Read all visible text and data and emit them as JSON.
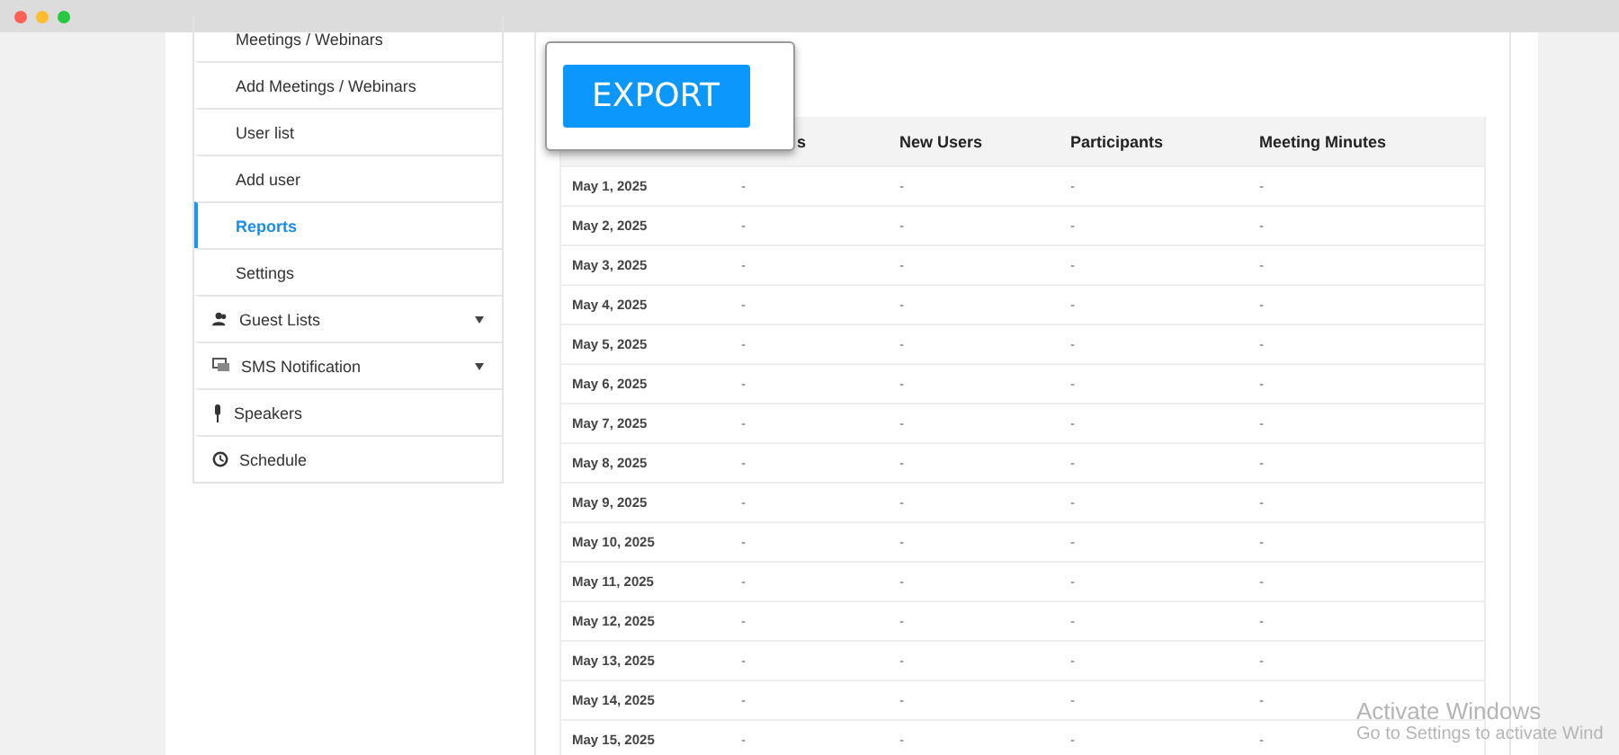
{
  "sidebar": {
    "items": [
      {
        "label": "Meetings / Webinars",
        "kind": "link",
        "selected": false
      },
      {
        "label": "Add Meetings / Webinars",
        "kind": "link",
        "selected": false
      },
      {
        "label": "User list",
        "kind": "link",
        "selected": false
      },
      {
        "label": "Add user",
        "kind": "link",
        "selected": false
      },
      {
        "label": "Reports",
        "kind": "link",
        "selected": true
      },
      {
        "label": "Settings",
        "kind": "link",
        "selected": false
      },
      {
        "label": "Guest Lists",
        "kind": "menu",
        "expandable": true,
        "selected": false
      },
      {
        "label": "SMS Notification",
        "kind": "menu",
        "expandable": true,
        "selected": false
      },
      {
        "label": "Speakers",
        "kind": "menu",
        "expandable": false,
        "selected": false
      },
      {
        "label": "Schedule",
        "kind": "menu",
        "expandable": false,
        "selected": false
      }
    ]
  },
  "export_popup": {
    "button": "EXPORT"
  },
  "table": {
    "columns": [
      "",
      "s",
      "New Users",
      "Participants",
      "Meeting Minutes"
    ],
    "rows": [
      [
        "May 1, 2025",
        "-",
        "-",
        "-",
        "-"
      ],
      [
        "May 2, 2025",
        "-",
        "-",
        "-",
        "-"
      ],
      [
        "May 3, 2025",
        "-",
        "-",
        "-",
        "-"
      ],
      [
        "May 4, 2025",
        "-",
        "-",
        "-",
        "-"
      ],
      [
        "May 5, 2025",
        "-",
        "-",
        "-",
        "-"
      ],
      [
        "May 6, 2025",
        "-",
        "-",
        "-",
        "-"
      ],
      [
        "May 7, 2025",
        "-",
        "-",
        "-",
        "-"
      ],
      [
        "May 8, 2025",
        "-",
        "-",
        "-",
        "-"
      ],
      [
        "May 9, 2025",
        "-",
        "-",
        "-",
        "-"
      ],
      [
        "May 10, 2025",
        "-",
        "-",
        "-",
        "-"
      ],
      [
        "May 11, 2025",
        "-",
        "-",
        "-",
        "-"
      ],
      [
        "May 12, 2025",
        "-",
        "-",
        "-",
        "-"
      ],
      [
        "May 13, 2025",
        "-",
        "-",
        "-",
        "-"
      ],
      [
        "May 14, 2025",
        "-",
        "-",
        "-",
        "-"
      ],
      [
        "May 15, 2025",
        "-",
        "-",
        "-",
        "-"
      ]
    ]
  },
  "os_notice": {
    "title": "Activate Windows",
    "subtitle": "Go to Settings to activate Wind"
  }
}
